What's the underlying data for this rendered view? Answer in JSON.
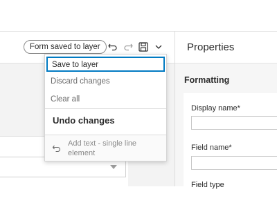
{
  "toolbar": {
    "status": "Form saved to layer",
    "undo_icon": "undo-icon",
    "redo_icon": "redo-icon",
    "save_icon": "floppy-disk-icon",
    "more_icon": "chevron-down-icon"
  },
  "save_menu": {
    "items": [
      {
        "label": "Save to layer",
        "enabled": true
      },
      {
        "label": "Discard changes",
        "enabled": false
      },
      {
        "label": "Clear all",
        "enabled": false
      }
    ],
    "group_title": "Undo changes",
    "undo_items": [
      {
        "label": "Add text - single line element",
        "icon": "undo-icon"
      }
    ]
  },
  "properties": {
    "title": "Properties",
    "section_title": "Formatting",
    "fields": [
      {
        "label": "Display name*",
        "value": ""
      },
      {
        "label": "Field name*",
        "value": ""
      },
      {
        "label": "Field type"
      }
    ]
  },
  "colors": {
    "focus": "#007ac2",
    "text": "#2b2b2b",
    "muted": "#6a6a6a",
    "border": "#d4d4d4"
  }
}
